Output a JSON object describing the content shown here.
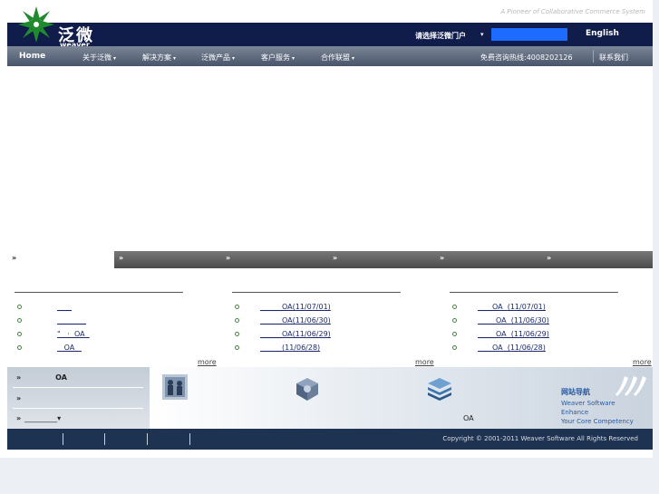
{
  "header": {
    "slogan": "A Pioneer of Collaborative Commerce System",
    "logo_cn": "泛微",
    "logo_en": "weaver",
    "portal_label": "请选择泛微门户",
    "portal_caret": "▾",
    "search_value": "",
    "english_link": "English"
  },
  "nav": {
    "home": "Home",
    "items": [
      "关于泛微",
      "解决方案",
      "泛微产品",
      "客户服务",
      "合作联盟"
    ],
    "caret": "▾",
    "hotline": "免费咨询热线:4008202126",
    "contact": "联系我们"
  },
  "tabs": {
    "arrow": "»"
  },
  "news": {
    "col1": [
      "____",
      "________",
      "\"   ·  OA  ",
      "   OA   "
    ],
    "col2": [
      "______OA(11/07/01)",
      "______OA(11/06/30)",
      "______OA(11/06/29)",
      "______(11/06/28)"
    ],
    "col3": [
      "____OA  (11/07/01)",
      "_____OA  (11/06/30)",
      "_____OA  (11/06/29)",
      "____OA  (11/06/28)"
    ],
    "more": "more"
  },
  "bottom_panel": {
    "left_row1_arrow": "»",
    "left_row1_text": "OA",
    "left_row2_arrow": "»",
    "left_row3_arrow": "»",
    "left_row3_text": "_________▾",
    "oa_label": "OA",
    "sitenav_title": "网站导航",
    "sitenav_line1": "Weaver Software",
    "sitenav_line2": "Enhance",
    "sitenav_line3": "Your Core Competency"
  },
  "footer": {
    "copyright": "Copyright © 2001-2011 Weaver Software All Rights Reserved"
  },
  "colors": {
    "header_bg": "#101c4a",
    "search_bg": "#1e6cff",
    "footer_bg": "#1e3252"
  }
}
